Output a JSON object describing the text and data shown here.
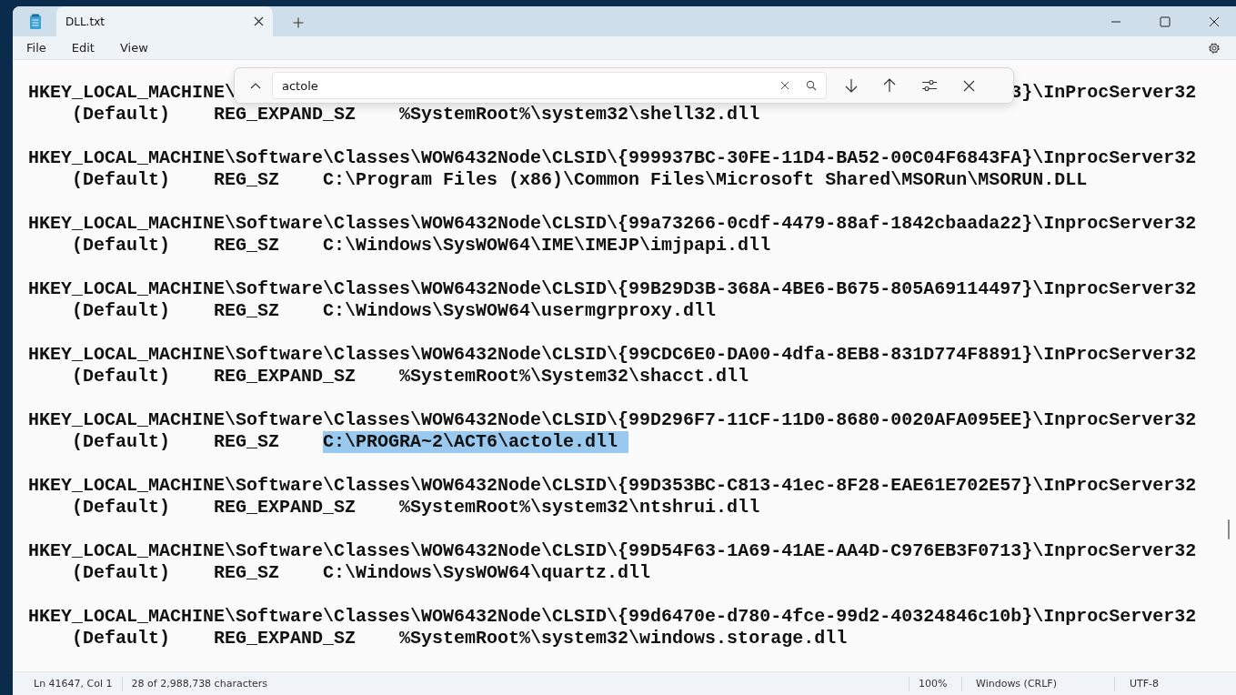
{
  "window": {
    "tab": {
      "title": "DLL.txt",
      "selected": true
    }
  },
  "menu": [
    "File",
    "Edit",
    "View"
  ],
  "find": {
    "value": "actole"
  },
  "first_record": {
    "key_left": "HKEY_LOCAL_MACHINE\\",
    "key_right": "3}\\InProcServer32",
    "name": "(Default)",
    "type": "REG_EXPAND_SZ",
    "value": "%SystemRoot%\\system32\\shell32.dll"
  },
  "records": [
    {
      "key": "HKEY_LOCAL_MACHINE\\Software\\Classes\\WOW6432Node\\CLSID\\{999937BC-30FE-11D4-BA52-00C04F6843FA}\\InprocServer32",
      "name": "(Default)",
      "type": "REG_SZ",
      "value": "C:\\Program Files (x86)\\Common Files\\Microsoft Shared\\MSORun\\MSORUN.DLL",
      "selected": false
    },
    {
      "key": "HKEY_LOCAL_MACHINE\\Software\\Classes\\WOW6432Node\\CLSID\\{99a73266-0cdf-4479-88af-1842cbaada22}\\InprocServer32",
      "name": "(Default)",
      "type": "REG_SZ",
      "value": "C:\\Windows\\SysWOW64\\IME\\IMEJP\\imjpapi.dll",
      "selected": false
    },
    {
      "key": "HKEY_LOCAL_MACHINE\\Software\\Classes\\WOW6432Node\\CLSID\\{99B29D3B-368A-4BE6-B675-805A69114497}\\InprocServer32",
      "name": "(Default)",
      "type": "REG_SZ",
      "value": "C:\\Windows\\SysWOW64\\usermgrproxy.dll",
      "selected": false
    },
    {
      "key": "HKEY_LOCAL_MACHINE\\Software\\Classes\\WOW6432Node\\CLSID\\{99CDC6E0-DA00-4dfa-8EB8-831D774F8891}\\InProcServer32",
      "name": "(Default)",
      "type": "REG_EXPAND_SZ",
      "value": "%SystemRoot%\\System32\\shacct.dll",
      "selected": false
    },
    {
      "key": "HKEY_LOCAL_MACHINE\\Software\\Classes\\WOW6432Node\\CLSID\\{99D296F7-11CF-11D0-8680-0020AFA095EE}\\InprocServer32",
      "name": "(Default)",
      "type": "REG_SZ",
      "value": "C:\\PROGRA~2\\ACT6\\actole.dll",
      "selected": true
    },
    {
      "key": "HKEY_LOCAL_MACHINE\\Software\\Classes\\WOW6432Node\\CLSID\\{99D353BC-C813-41ec-8F28-EAE61E702E57}\\InProcServer32",
      "name": "(Default)",
      "type": "REG_EXPAND_SZ",
      "value": "%SystemRoot%\\system32\\ntshrui.dll",
      "selected": false
    },
    {
      "key": "HKEY_LOCAL_MACHINE\\Software\\Classes\\WOW6432Node\\CLSID\\{99D54F63-1A69-41AE-AA4D-C976EB3F0713}\\InprocServer32",
      "name": "(Default)",
      "type": "REG_SZ",
      "value": "C:\\Windows\\SysWOW64\\quartz.dll",
      "selected": false
    },
    {
      "key": "HKEY_LOCAL_MACHINE\\Software\\Classes\\WOW6432Node\\CLSID\\{99d6470e-d780-4fce-99d2-40324846c10b}\\InprocServer32",
      "name": "(Default)",
      "type": "REG_EXPAND_SZ",
      "value": "%SystemRoot%\\system32\\windows.storage.dll",
      "selected": false
    }
  ],
  "status_bar": {
    "position": "Ln 41647, Col 1",
    "characters": "28 of 2,988,738 characters",
    "zoom": "100%",
    "line_endings": "Windows (CRLF)",
    "encoding": "UTF-8"
  }
}
